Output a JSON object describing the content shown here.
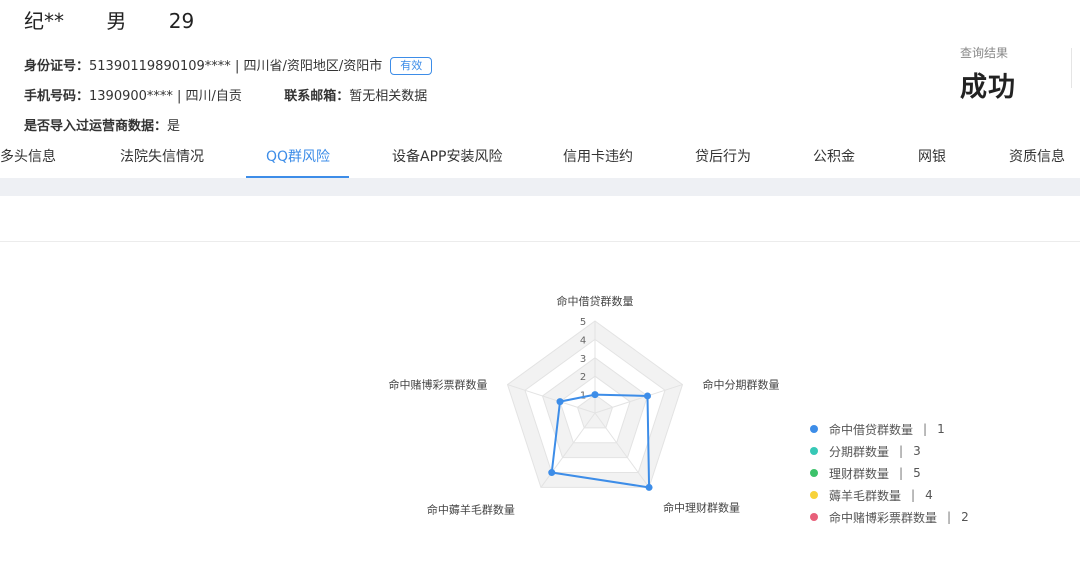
{
  "person": {
    "name": "纪**",
    "gender": "男",
    "age": "29"
  },
  "info": {
    "id_label": "身份证号：",
    "id_value": "51390119890109**** | 四川省/资阳地区/资阳市",
    "id_status": "有效",
    "phone_label": "手机号码：",
    "phone_value": "1390900**** | 四川/自贡",
    "email_label": "联系邮箱：",
    "email_value": "暂无相关数据",
    "operator_label": "是否导入过运营商数据：",
    "operator_value": "是"
  },
  "result": {
    "label": "查询结果",
    "value": "成功"
  },
  "tabs": [
    {
      "label": "多头信息"
    },
    {
      "label": "法院失信情况"
    },
    {
      "label": "QQ群风险",
      "active": true
    },
    {
      "label": "设备APP安装风险"
    },
    {
      "label": "信用卡违约"
    },
    {
      "label": "贷后行为"
    },
    {
      "label": "公积金"
    },
    {
      "label": "网银"
    },
    {
      "label": "资质信息"
    }
  ],
  "chart_data": {
    "type": "radar",
    "indicators": [
      "命中借贷群数量",
      "命中分期群数量",
      "命中理财群数量",
      "命中薅羊毛群数量",
      "命中赌博彩票群数量"
    ],
    "max": 5,
    "ticks": [
      "1",
      "2",
      "3",
      "4",
      "5"
    ],
    "values": [
      1,
      3,
      5,
      4,
      2
    ],
    "line_color": "#3d8de8",
    "legend": [
      {
        "name": "命中借贷群数量",
        "value": "1",
        "color": "#3d8de8"
      },
      {
        "name": "分期群数量",
        "value": "3",
        "color": "#37c8b6"
      },
      {
        "name": "理财群数量",
        "value": "5",
        "color": "#3cc26a"
      },
      {
        "name": "薅羊毛群数量",
        "value": "4",
        "color": "#f7d23a"
      },
      {
        "name": "命中赌博彩票群数量",
        "value": "2",
        "color": "#e8607a"
      }
    ]
  }
}
